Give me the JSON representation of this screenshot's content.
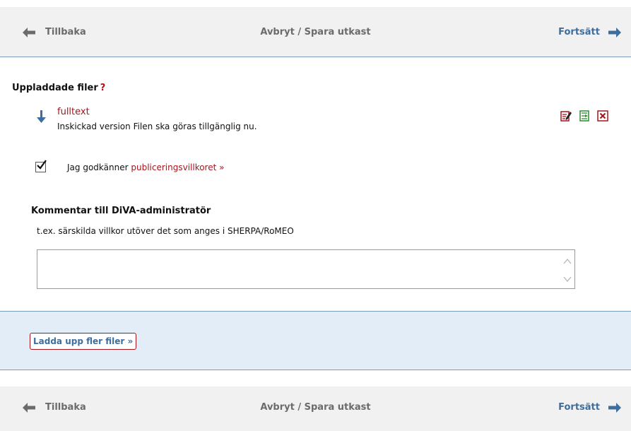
{
  "nav": {
    "back_label": "Tillbaka",
    "middle_label": "Avbryt / Spara utkast",
    "next_label": "Fortsätt"
  },
  "uploaded": {
    "title": "Uppladdade filer",
    "help": "?",
    "file": {
      "name": "fulltext",
      "description": "Inskickad version Filen ska göras tillgänglig nu.",
      "actions": [
        "edit-icon",
        "replace-icon",
        "delete-icon"
      ]
    }
  },
  "consent": {
    "checked": true,
    "text": "Jag godkänner",
    "link": "publiceringsvillkoret »"
  },
  "comment": {
    "title": "Kommentar till DiVA-administratör",
    "hint": "t.ex. särskilda villkor utöver det som anges i SHERPA/RoMEO",
    "value": ""
  },
  "upload_more": {
    "label": "Ladda upp fler filer »"
  },
  "colors": {
    "nav_bg": "#f1f1f1",
    "link_red": "#a5151c",
    "link_blue": "#3e6e9e",
    "panel_blue": "#e3edf8",
    "border_blue": "#7a9cc1",
    "action_green": "#2e8b2e"
  }
}
